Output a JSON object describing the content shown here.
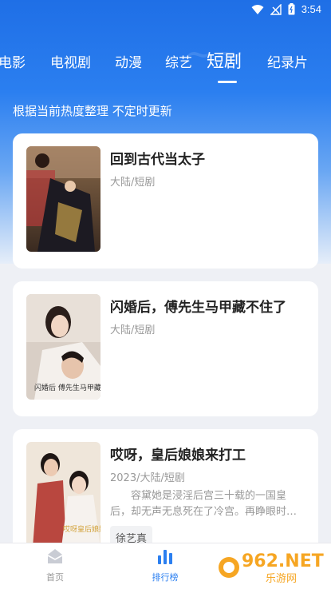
{
  "status_bar": {
    "time": "3:54"
  },
  "tabs": [
    {
      "label": "电影"
    },
    {
      "label": "电视剧"
    },
    {
      "label": "动漫"
    },
    {
      "label": "综艺"
    },
    {
      "label": "短剧",
      "active": true
    },
    {
      "label": "纪录片"
    }
  ],
  "subtitle": "根据当前热度整理 不定时更新",
  "items": [
    {
      "title": "回到古代当太子",
      "meta": "大陆/短剧"
    },
    {
      "title": "闪婚后，傅先生马甲藏不住了",
      "meta": "大陆/短剧",
      "poster_text": "闪婚后 傅先生马甲藏不住了"
    },
    {
      "title": "哎呀，皇后娘娘来打工",
      "meta": "2023/大陆/短剧",
      "description": "容黛她是浸淫后宫三十载的一国皇后，却无声无息死在了冷宫。再睁眼时…",
      "tag": "徐艺真",
      "poster_text": "哎呀皇后娘娘来打工"
    }
  ],
  "bottom_nav": [
    {
      "label": "首页",
      "icon": "home-icon"
    },
    {
      "label": "排行榜",
      "icon": "ranking-icon",
      "active": true
    }
  ],
  "watermark": {
    "text": "962.NET",
    "subtext": "乐游网"
  },
  "colors": {
    "accent": "#2b7ff0",
    "active_nav": "#2b7ff0",
    "inactive_nav": "#999999"
  }
}
